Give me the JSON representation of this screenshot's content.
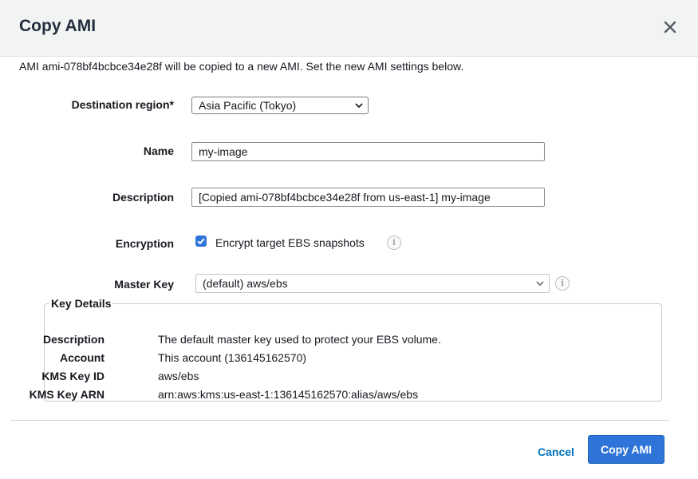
{
  "dialog": {
    "title": "Copy AMI",
    "intro": "AMI ami-078bf4bcbce34e28f will be copied to a new AMI. Set the new AMI settings below."
  },
  "form": {
    "destination_region": {
      "label": "Destination region*",
      "value": "Asia Pacific (Tokyo)"
    },
    "name": {
      "label": "Name",
      "value": "my-image"
    },
    "description": {
      "label": "Description",
      "value": "[Copied ami-078bf4bcbce34e28f from us-east-1] my-image"
    },
    "encryption": {
      "label": "Encryption",
      "checkbox_label": "Encrypt target EBS snapshots",
      "checked": true
    },
    "master_key": {
      "label": "Master Key",
      "value": "(default) aws/ebs"
    }
  },
  "key_details": {
    "legend": "Key Details",
    "rows": [
      {
        "key": "Description",
        "value": "The default master key used to protect your EBS volume."
      },
      {
        "key": "Account",
        "value": "This account (136145162570)"
      },
      {
        "key": "KMS Key ID",
        "value": "aws/ebs"
      },
      {
        "key": "KMS Key ARN",
        "value": "arn:aws:kms:us-east-1:136145162570:alias/aws/ebs"
      }
    ]
  },
  "footer": {
    "cancel_label": "Cancel",
    "primary_label": "Copy AMI"
  },
  "icons": {
    "close": "close-icon",
    "info": "info-icon",
    "chevron": "chevron-down-icon",
    "check": "checkmark-icon"
  },
  "colors": {
    "header_bg": "#f2f3f3",
    "primary": "#2f75d9",
    "link": "#0073bb"
  }
}
